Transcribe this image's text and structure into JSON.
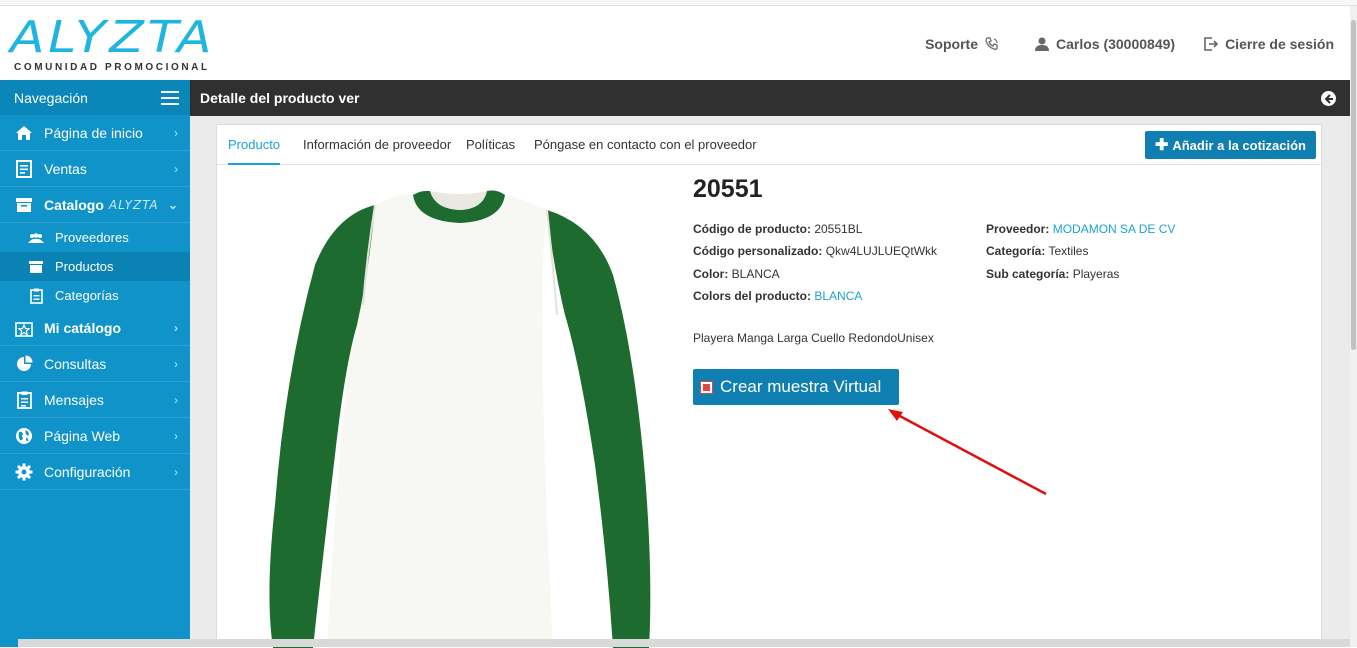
{
  "header": {
    "logo_text": "ALYZTA",
    "logo_subtitle": "COMUNIDAD PROMOCIONAL",
    "support_label": "Soporte",
    "user_label": "Carlos (30000849)",
    "logout_label": "Cierre de sesión"
  },
  "sidebar": {
    "title": "Navegación",
    "items": [
      {
        "label": "Página de inicio",
        "icon": "home-icon"
      },
      {
        "label": "Ventas",
        "icon": "invoice-icon"
      },
      {
        "label": "Catalogo",
        "tag": "ALYZTA",
        "icon": "box-icon"
      },
      {
        "label": "Mi catálogo",
        "icon": "star-icon"
      },
      {
        "label": "Consultas",
        "icon": "pie-chart-icon"
      },
      {
        "label": "Mensajes",
        "icon": "clipboard-icon"
      },
      {
        "label": "Página Web",
        "icon": "globe-icon"
      },
      {
        "label": "Configuración",
        "icon": "gear-icon"
      }
    ],
    "subitems": [
      {
        "label": "Proveedores",
        "icon": "users-icon"
      },
      {
        "label": "Productos",
        "icon": "archive-icon"
      },
      {
        "label": "Categorías",
        "icon": "list-icon"
      }
    ]
  },
  "page": {
    "title": "Detalle del producto ver"
  },
  "tabs": [
    {
      "label": "Producto"
    },
    {
      "label": "Información de proveedor"
    },
    {
      "label": "Políticas"
    },
    {
      "label": "Póngase en contacto con el proveedor"
    }
  ],
  "add_quote_label": "Añadir a la cotización",
  "product": {
    "name": "20551",
    "code_label": "Código de producto:",
    "code": "20551BL",
    "custom_code_label": "Código personalizado:",
    "custom_code": "Qkw4LUJLUEQtWkk",
    "color_label": "Color:",
    "color": "BLANCA",
    "colors_label": "Colors del producto:",
    "colors": "BLANCA",
    "supplier_label": "Proveedor:",
    "supplier": "MODAMON SA DE CV",
    "category_label": "Categoría:",
    "category": "Textiles",
    "subcategory_label": "Sub categoría:",
    "subcategory": "Playeras",
    "description": "Playera Manga Larga Cuello RedondoUnisex",
    "virtual_button": "Crear muestra Virtual"
  },
  "colors": {
    "brand": "#0f93c9",
    "accent": "#1aa3d6",
    "button": "#0f7eb0",
    "titlebar": "#303030",
    "arrow": "#e01010",
    "shirt_sleeve": "#1d6b2e"
  }
}
